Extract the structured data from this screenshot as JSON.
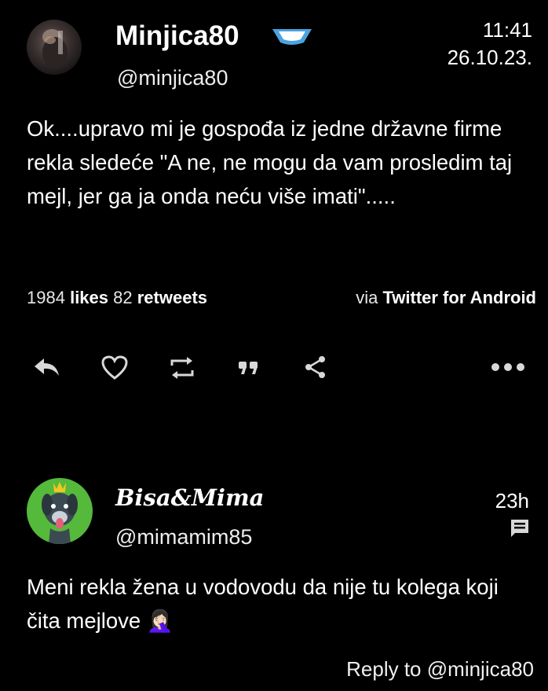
{
  "tweet": {
    "display_name": "Minjica80",
    "handle": "@minjica80",
    "time": "11:41",
    "date": "26.10.23.",
    "text": "Ok....upravo mi je gospođa iz jedne državne firme rekla sledeće \"A ne, ne mogu da vam prosledim taj mejl, jer ga ja onda neću više imati\".....",
    "likes_count": "1984",
    "likes_label": "likes",
    "retweets_count": "82",
    "retweets_label": "retweets",
    "via_label": "via",
    "client": "Twitter for Android",
    "actions": [
      "reply-icon",
      "heart-icon",
      "retweet-icon",
      "quote-icon",
      "share-icon",
      "more-icon"
    ]
  },
  "reply": {
    "display_name": "Bisa&Mima",
    "handle": "@mimamim85",
    "time": "23h",
    "text": "Meni rekla žena u vodovodu da nije tu kolega koji čita mejlove",
    "emoji": "🤦🏻‍♀️",
    "reply_to_label": "Reply to",
    "reply_to_handle": "@minjica80"
  },
  "colors": {
    "background": "#000000",
    "text": "#ffffff",
    "badge": "#4aa3df",
    "avatar2": "#55b93c"
  }
}
